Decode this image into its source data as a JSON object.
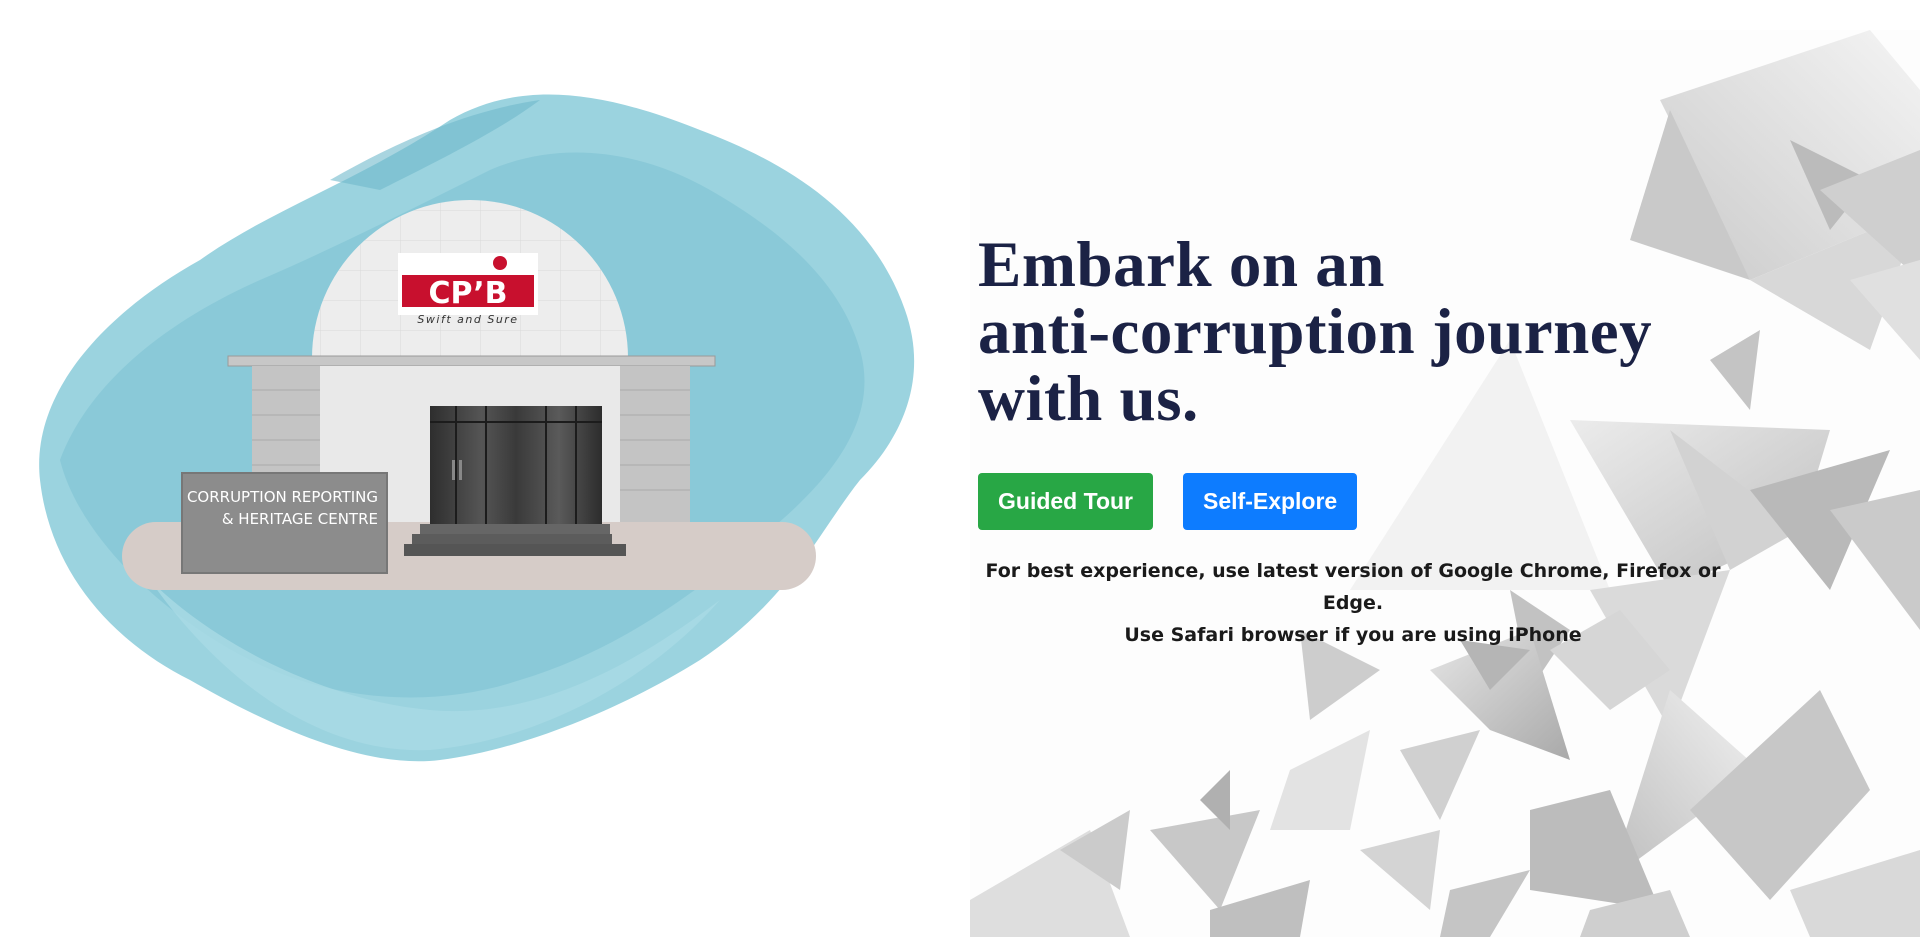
{
  "hero": {
    "headline_lines": [
      "Embark on an",
      "anti-corruption journey",
      "with us."
    ],
    "buttons": {
      "guided_tour": "Guided Tour",
      "self_explore": "Self-Explore"
    },
    "note_lines": [
      "For best experience, use latest version of Google Chrome, Firefox or Edge.",
      "Use Safari browser if you are using iPhone"
    ]
  },
  "illustration": {
    "logo_text": "CP’B",
    "logo_tagline": "Swift and Sure",
    "sign_lines": [
      "CORRUPTION REPORTING",
      "& HERITAGE CENTRE"
    ]
  },
  "colors": {
    "headline": "#1b2245",
    "guided_tour_button": "#28a745",
    "self_explore_button": "#0d7cff",
    "watercolor": "#8fcfdc",
    "logo_red": "#c8102e"
  }
}
